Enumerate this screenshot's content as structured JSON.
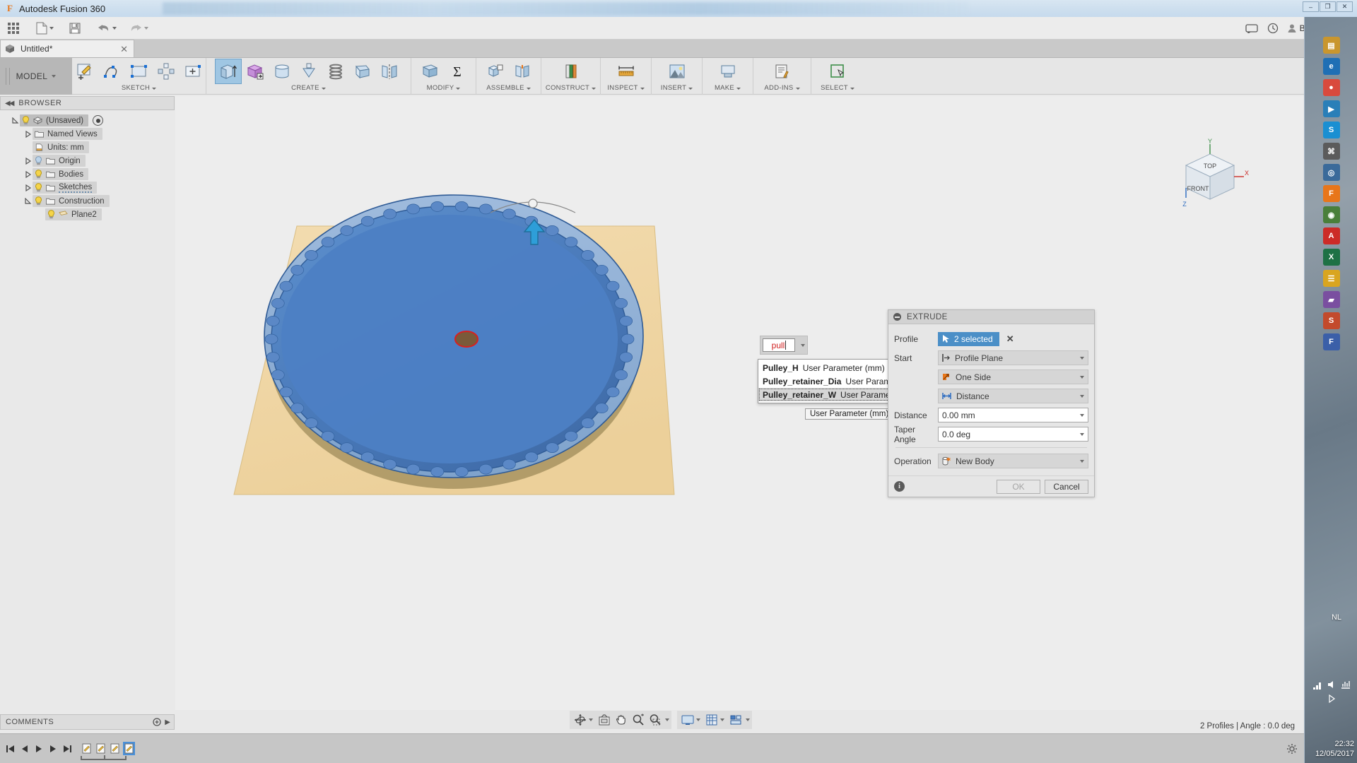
{
  "titlebar": {
    "app_title": "Autodesk Fusion 360",
    "logo_letter": "F",
    "minimize": "–",
    "maximize": "❐",
    "close": "✕"
  },
  "quick_access": {
    "grid_icon": "app-grid-icon",
    "new_label": "new-document",
    "save_label": "save",
    "undo_label": "undo",
    "redo_label": "redo",
    "user_name": "Br Hel",
    "help_label": "?"
  },
  "document_tab": {
    "title": "Untitled*",
    "close": "✕"
  },
  "ribbon": {
    "workspace": "MODEL",
    "groups": [
      {
        "label": "SKETCH",
        "icons": [
          "create-sketch-icon",
          "spline-icon",
          "rectangle-icon",
          "pattern-icon",
          "sketch-dimension-icon"
        ]
      },
      {
        "label": "CREATE",
        "icons": [
          "extrude-icon",
          "box-icon",
          "revolve-icon",
          "cylinder-icon",
          "sphere-icon",
          "coil-icon",
          "rib-icon",
          "mirror-icon"
        ]
      },
      {
        "label": "MODIFY",
        "icons": [
          "press-pull-icon",
          "sum-icon"
        ]
      },
      {
        "label": "ASSEMBLE",
        "icons": [
          "new-component-icon",
          "joint-icon"
        ]
      },
      {
        "label": "CONSTRUCT",
        "icons": [
          "offset-plane-icon"
        ]
      },
      {
        "label": "INSPECT",
        "icons": [
          "measure-icon"
        ]
      },
      {
        "label": "INSERT",
        "icons": [
          "insert-image-icon"
        ]
      },
      {
        "label": "MAKE",
        "icons": [
          "3d-print-icon"
        ]
      },
      {
        "label": "ADD-INS",
        "icons": [
          "scripts-icon"
        ]
      },
      {
        "label": "SELECT",
        "icons": [
          "select-icon"
        ]
      }
    ]
  },
  "browser": {
    "header": "BROWSER",
    "collapse_icon": "collapse-left-icon",
    "items": [
      {
        "label": "(Unsaved)",
        "indent": 0,
        "disclosure": "expanded",
        "bulb": "on",
        "icon": "document-icon",
        "selected": true,
        "eye": true
      },
      {
        "label": "Named Views",
        "indent": 1,
        "disclosure": "collapsed",
        "bulb": "none",
        "icon": "folder-icon"
      },
      {
        "label": "Units: mm",
        "indent": 1,
        "disclosure": "none",
        "bulb": "none",
        "icon": "units-icon"
      },
      {
        "label": "Origin",
        "indent": 1,
        "disclosure": "collapsed",
        "bulb": "off",
        "icon": "folder-icon"
      },
      {
        "label": "Bodies",
        "indent": 1,
        "disclosure": "collapsed",
        "bulb": "on",
        "icon": "folder-icon"
      },
      {
        "label": "Sketches",
        "indent": 1,
        "disclosure": "collapsed",
        "bulb": "on",
        "icon": "folder-icon",
        "dashed": true
      },
      {
        "label": "Construction",
        "indent": 1,
        "disclosure": "expanded",
        "bulb": "on",
        "icon": "folder-icon"
      },
      {
        "label": "Plane2",
        "indent": 2,
        "disclosure": "none",
        "bulb": "on",
        "icon": "plane-icon"
      }
    ]
  },
  "viewcube": {
    "top_face": "TOP",
    "front_face": "FRONT",
    "axis_x": "X",
    "axis_y": "Y",
    "axis_z": "Z"
  },
  "extrude_dialog": {
    "title": "EXTRUDE",
    "minimize_icon": "collapse-dialog-icon",
    "rows": [
      {
        "label": "Profile",
        "type": "selection",
        "value": "2 selected",
        "clear_icon": "clear-selection-icon"
      },
      {
        "label": "Start",
        "type": "dropdown",
        "value": "Profile Plane",
        "icon": "start-plane-icon"
      },
      {
        "label": "",
        "type": "dropdown",
        "value": "One Side",
        "icon": "direction-one-side-icon"
      },
      {
        "label": "",
        "type": "dropdown",
        "value": "Distance",
        "icon": "extent-distance-icon"
      },
      {
        "label": "Distance",
        "type": "textfield",
        "value": "0.00 mm"
      },
      {
        "label": "Taper Angle",
        "type": "textfield",
        "value": "0.0 deg"
      },
      {
        "label": "Operation",
        "type": "dropdown",
        "value": "New Body",
        "icon": "new-body-icon"
      }
    ],
    "info_icon": "info-icon",
    "ok_label": "OK",
    "cancel_label": "Cancel"
  },
  "param_input": {
    "value": "pull",
    "dropdown_icon": "chevron-down-icon",
    "suggestions": [
      {
        "name": "Pulley_H",
        "desc": "User Parameter (mm)",
        "selected": false
      },
      {
        "name": "Pulley_retainer_Dia",
        "desc": "User Parameter (mm)",
        "selected": false
      },
      {
        "name": "Pulley_retainer_W",
        "desc": "User Parameter (mm)",
        "selected": true
      }
    ],
    "tooltip": "User Parameter (mm)"
  },
  "navbar": {
    "buttons": [
      {
        "name": "orbit-icon",
        "caret": true
      },
      {
        "name": "look-at-icon",
        "caret": false
      },
      {
        "name": "pan-icon",
        "caret": false
      },
      {
        "name": "zoom-icon",
        "caret": false
      },
      {
        "name": "zoom-window-icon",
        "caret": true
      },
      {
        "name": "display-settings-icon",
        "caret": true
      },
      {
        "name": "grid-snaps-icon",
        "caret": true
      },
      {
        "name": "viewports-icon",
        "caret": true
      }
    ]
  },
  "comments": {
    "label": "COMMENTS",
    "add_icon": "add-comment-icon"
  },
  "status_bar": {
    "text": "2 Profiles | Angle : 0.0 deg"
  },
  "timeline": {
    "nav": [
      "jump-start-icon",
      "step-back-icon",
      "play-icon",
      "step-forward-icon",
      "jump-end-icon"
    ],
    "nodes": [
      {
        "name": "sketch-feature-icon",
        "selected": false
      },
      {
        "name": "plane-feature-icon",
        "selected": false
      },
      {
        "name": "extrude-feature-icon",
        "selected": false
      },
      {
        "name": "sketch-feature-icon",
        "selected": true
      }
    ],
    "settings_icon": "settings-gear-icon"
  },
  "right_dock": {
    "keyboard_layout": "NL",
    "time": "22:32",
    "date": "12/05/2017",
    "icons": [
      {
        "name": "folder-icon",
        "glyph": "▤",
        "color": "#c9962e"
      },
      {
        "name": "browser-icon",
        "glyph": "e",
        "color": "#1f6fb5"
      },
      {
        "name": "chrome-icon",
        "glyph": "●",
        "color": "#d94a3d"
      },
      {
        "name": "media-icon",
        "glyph": "▶",
        "color": "#2a7fb8"
      },
      {
        "name": "skype-icon",
        "glyph": "S",
        "color": "#1a8fd2"
      },
      {
        "name": "lock-icon",
        "glyph": "⌘",
        "color": "#5b5b5b"
      },
      {
        "name": "disc-icon",
        "glyph": "◎",
        "color": "#3a6a9a"
      },
      {
        "name": "fusion-icon",
        "glyph": "F",
        "color": "#e8761a"
      },
      {
        "name": "camera-icon",
        "glyph": "◉",
        "color": "#4a7f3a"
      },
      {
        "name": "pdf-icon",
        "glyph": "A",
        "color": "#cc2b27"
      },
      {
        "name": "excel-icon",
        "glyph": "X",
        "color": "#1e7145"
      },
      {
        "name": "notes-icon",
        "glyph": "☰",
        "color": "#d9a520"
      },
      {
        "name": "paint-icon",
        "glyph": "▰",
        "color": "#7a4fa0"
      },
      {
        "name": "store-icon",
        "glyph": "S",
        "color": "#c34a2c"
      },
      {
        "name": "font-icon",
        "glyph": "F",
        "color": "#3b5fa8"
      }
    ]
  },
  "colors": {
    "accent_blue": "#4b8fc7",
    "selection_blue": "#9fc6e3",
    "canvas_bg": "#ededed",
    "plane_tan": "#f0d7a8",
    "body_blue": "#4a7fc1",
    "highlight_orange": "#e8761a",
    "red_text": "#d02020"
  }
}
